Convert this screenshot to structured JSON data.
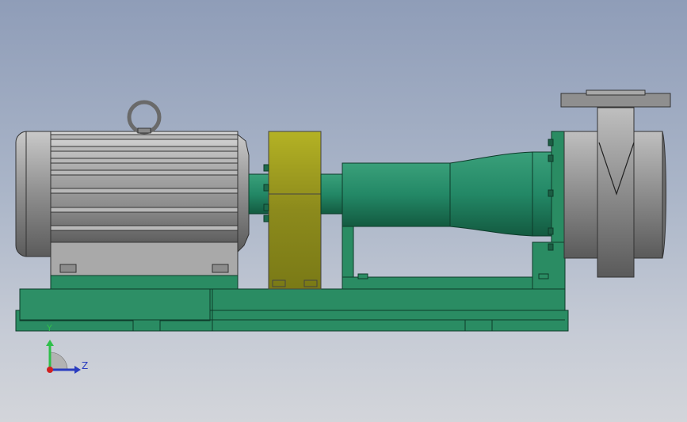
{
  "viewport": {
    "background_top": "#8f9db8",
    "background_bottom": "#d3d5da"
  },
  "model": {
    "description_colors": {
      "base_frame": "#2a8c63",
      "pump_body": "#238866",
      "coupling_guard": "#a8a62a",
      "motor": "#9a9a9a",
      "casing": "#8c8c8c"
    }
  },
  "triad": {
    "y_label": "Y",
    "z_label": "Z",
    "y_color": "#2fbf4a",
    "z_color": "#2a3cbf",
    "x_color": "#d02020"
  }
}
